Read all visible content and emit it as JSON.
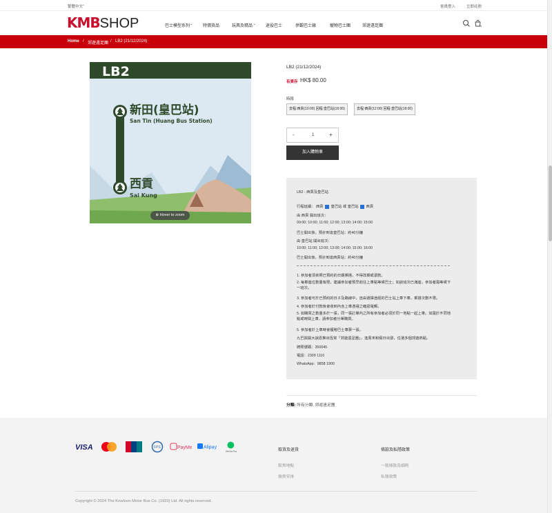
{
  "topbar": {
    "language": "繁體中文",
    "login": "會員登入",
    "register": "立即註冊"
  },
  "header": {
    "logo_kmb": "KMB",
    "logo_shop": "SHOP",
    "nav": [
      "巴士模型系列",
      "特價貨品",
      "玩具及精品",
      "退役巴士",
      "參觀巴士廠",
      "寵物巴士團",
      "郊遊遠足團"
    ]
  },
  "breadcrumb": {
    "home": "Home",
    "sep": "/",
    "category": "郊遊遠足團",
    "current": "LB2 (21/12/2024)"
  },
  "image": {
    "route": "LB2",
    "stop1_zh": "新田(皇巴站)",
    "stop1_en": "San Tin (Huang Bus Station)",
    "stop2_zh": "西貢",
    "stop2_en": "Sai Kung",
    "zoom_label": "Hover to zoom"
  },
  "product": {
    "title": "LB2 (21/12/2024)",
    "stock": "有貨存",
    "price": "HK$ 80.00",
    "option_label": "時段",
    "options": [
      "去程:西貢(10:00) 回程:皇巴站(16:00)",
      "去程:西貢(12:00) 回程:皇巴站(18:00)"
    ],
    "qty_minus": "-",
    "qty_value": "1",
    "qty_plus": "+",
    "add_to_cart": "加入購物車"
  },
  "description": {
    "route_name": "LB2 - 西貢及皇巴站",
    "itinerary_prefix": "行程延續： 西貢",
    "itinerary_mid": "皇巴站 或 皇巴站",
    "itinerary_end": "西貢",
    "from_saikung": "由 西貢 開出班次：",
    "times_saikung": "09:00; 10:00; 11:00; 12:00; 13:00; 14:00; 15:00",
    "travel_saikung": "巴士開出後，預計到達皇巴站：約40分鐘",
    "from_huangbus": "由 皇巴站 開出班次：",
    "times_huangbus": "10:00; 11:00; 12:00; 13:00; 14:00; 15:00; 16:00",
    "travel_huangbus": "巴士開出後，預計到達西貢站：約40分鐘",
    "note1": "1. 參加者須依照已預約的日期乘搭，不得改期或退款。",
    "note2": "2. 每車座位數量有限，建議參加者預早前往上車點等候巴士；如該班次已滿座，參加者需等候下一班次。",
    "note3": "3. 參加者可於已預約的日子及路線中，自由選擇途經的巴士站上車下車，乘搭次數不限。",
    "note4": "4. 參加者於付款後會收到內含上車憑證之確認電郵。",
    "note5": "5. 如購買之數量多於一張，同一張訂單內之所有參加者必須於同一地點一起上車。如需於不同地點或時間上車，請參加者分單購買。",
    "note6": "5. 參加者於上車時會獲贈巴士車票一張。",
    "promo": "九巴與開大說逐推出恆常「郊遊遠足團」，逢周末和假日出發，任選多個郊遊熱點。",
    "license": "牌照號碼：350045",
    "phone": "電話：2309 1116",
    "whatsapp": "WhatsApp：9858 1900"
  },
  "categories": {
    "label": "分類:",
    "value": "所有分類, 郊遊遠足團"
  },
  "footer": {
    "payments": [
      "VISA",
      "Mastercard",
      "UnionPay",
      "FPS",
      "PayMe",
      "Alipay",
      "WeChat Pay"
    ],
    "col1_title": "取貨及退貨",
    "col1_links": [
      "取貨地點",
      "換貨安排"
    ],
    "col2_title": "條款及私隱政策",
    "col2_links": [
      "一般條款及細則",
      "私隱政策"
    ],
    "copyright": "Copyright © 2024 The Kowloon Motor Bus Co. (1933) Ltd. All rights reserved."
  }
}
